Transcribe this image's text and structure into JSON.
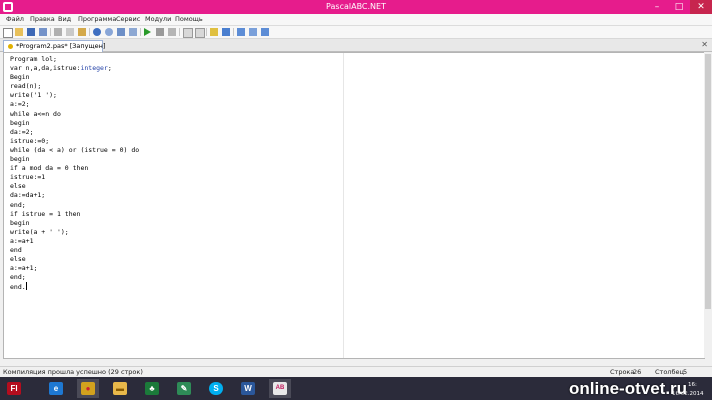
{
  "window": {
    "title": "PascalABC.NET",
    "minimize": "–",
    "maximize": "□",
    "close": "✕"
  },
  "menu": [
    "Файл",
    "Правка",
    "Вид",
    "Программа",
    "Сервис",
    "Модули",
    "Помощь"
  ],
  "toolbar": {
    "icons": [
      "new-file-icon",
      "open-icon",
      "save-icon",
      "save-all-icon",
      "cut-icon",
      "copy-icon",
      "paste-icon",
      "undo-icon",
      "redo-icon",
      "find-icon",
      "replace-icon",
      "run-icon",
      "stop-icon",
      "compile-icon",
      "format-icon",
      "debug-step-icon",
      "debug-into-icon",
      "output-window-icon",
      "close-window-icon",
      "tool-icon",
      "tool2-icon",
      "tool3-icon"
    ]
  },
  "tab": {
    "label": "*Program2.pas* [Запущен]",
    "close": "✕"
  },
  "editor": {
    "lines": [
      "Program lol;",
      "var n,a,da,istrue:integer;",
      "Begin",
      "read(n);",
      "write('1 ');",
      "a:=2;",
      "while a<=n do",
      "begin",
      "da:=2;",
      "istrue:=0;",
      "while (da < a) or (istrue = 0) do",
      "begin",
      "if a mod da = 0 then",
      "istrue:=1",
      "else",
      "da:=da+1;",
      "end;",
      "if istrue = 1 then",
      "begin",
      "write(a + ' ');",
      "a:=a+1",
      "end",
      "else",
      "a:=a+1;",
      "end;",
      "end."
    ]
  },
  "status": {
    "message": "Компиляция прошла успешно (29 строк)",
    "row_label": "Строка",
    "row_value": "26",
    "col_label": "Столбец",
    "col_value": "5"
  },
  "taskbar": {
    "apps": [
      {
        "name": "flash",
        "label": "Fl",
        "color": "#b40d1e"
      },
      {
        "name": "internet-explorer",
        "label": "e",
        "color": "#1e78d2"
      },
      {
        "name": "chrome",
        "label": "●",
        "color": "#d2a21e"
      },
      {
        "name": "explorer",
        "label": "▬",
        "color": "#e8b84a"
      },
      {
        "name": "solitaire",
        "label": "♣",
        "color": "#1b7a3a"
      },
      {
        "name": "notepad",
        "label": "✎",
        "color": "#2e8b57"
      },
      {
        "name": "skype",
        "label": "S",
        "color": "#00aff0"
      },
      {
        "name": "word",
        "label": "W",
        "color": "#2b579a"
      },
      {
        "name": "pascalabc",
        "label": "AB",
        "color": "#e8e8e8"
      }
    ],
    "clock_time": "16:",
    "clock_date": "16.02.2014"
  },
  "watermark": "online-otvet.ru"
}
